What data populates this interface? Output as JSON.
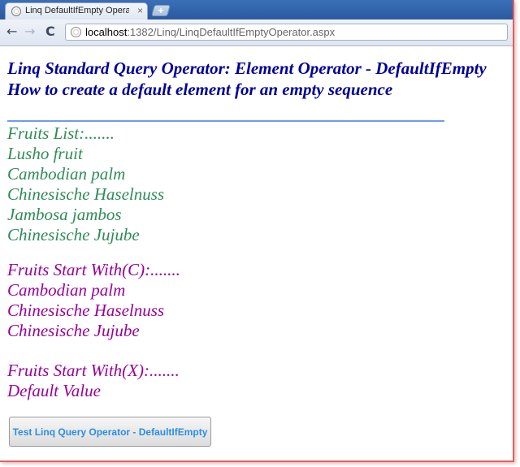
{
  "browser": {
    "tab_title": "Linq DefaultIfEmpty Operat",
    "tab_close": "×",
    "new_tab": "+",
    "nav_back": "←",
    "nav_forward": "→",
    "nav_reload": "C",
    "url_host": "localhost",
    "url_path": ":1382/Linq/LinqDefaultIfEmptyOperator.aspx",
    "icons": [
      "page-icon",
      "back-icon",
      "forward-icon",
      "reload-icon"
    ]
  },
  "page": {
    "title": "Linq Standard Query Operator: Element Operator - DefaultIfEmpty",
    "subtitle": "How to create a default element for an empty sequence",
    "fruits_list": {
      "header": "Fruits List:.......",
      "items": [
        "Lusho fruit",
        "Cambodian palm",
        "Chinesische Haselnuss",
        "Jambosa jambos",
        "Chinesische Jujube"
      ]
    },
    "fruits_c": {
      "header": "Fruits Start With(C):.......",
      "items": [
        "Cambodian palm",
        "Chinesische Haselnuss",
        "Chinesische Jujube"
      ]
    },
    "fruits_x": {
      "header": "Fruits Start With(X):.......",
      "items": [
        "Default Value"
      ]
    },
    "button_label": "Test Linq Query Operator - DefaultIfEmpty"
  },
  "colors": {
    "heading": "#000099",
    "list_green": "#2e8b57",
    "list_purple": "#990099",
    "rule": "#6f9bf2",
    "button_text": "#2a8ee6"
  }
}
